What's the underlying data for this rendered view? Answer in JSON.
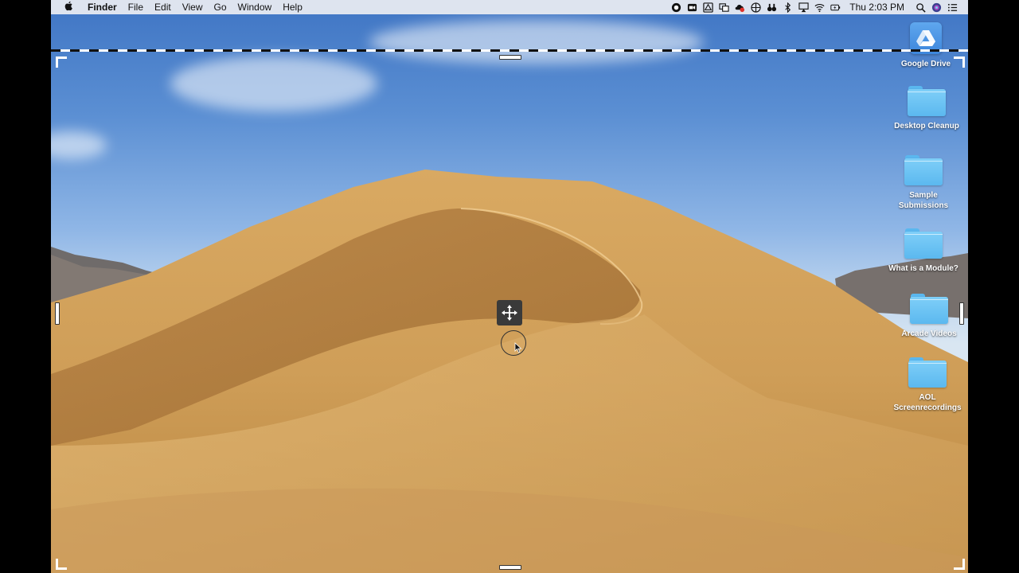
{
  "menubar": {
    "apple_icon": "apple-icon",
    "app_name": "Finder",
    "items": [
      "File",
      "Edit",
      "View",
      "Go",
      "Window",
      "Help"
    ],
    "clock": "Thu 2:03 PM",
    "status_icons": [
      "record-icon",
      "zoom-icon",
      "drive-icon",
      "screen-share-icon",
      "creative-cloud-icon",
      "target-icon",
      "binoculars-icon",
      "bluetooth-icon",
      "airplay-icon",
      "wifi-icon",
      "battery-icon"
    ],
    "right_icons": [
      "spotlight-icon",
      "siri-icon",
      "notification-center-icon"
    ]
  },
  "desktop": {
    "icons": [
      {
        "label": "Google Drive",
        "type": "gdrive"
      },
      {
        "label": "Desktop Cleanup",
        "type": "folder"
      },
      {
        "label": "Sample Submissions",
        "type": "folder"
      },
      {
        "label": "What is a Module?",
        "type": "folder"
      },
      {
        "label": "Arcade Videos",
        "type": "folder"
      },
      {
        "label": "AOL Screenrecordings",
        "type": "folder"
      }
    ]
  },
  "capture_overlay": {
    "move_icon": "move-arrows-icon",
    "cursor": "pointer-cursor-icon"
  },
  "colors": {
    "folder": "#5bb8ef",
    "sky_top": "#3f75c4",
    "dune": "#d6a865"
  }
}
